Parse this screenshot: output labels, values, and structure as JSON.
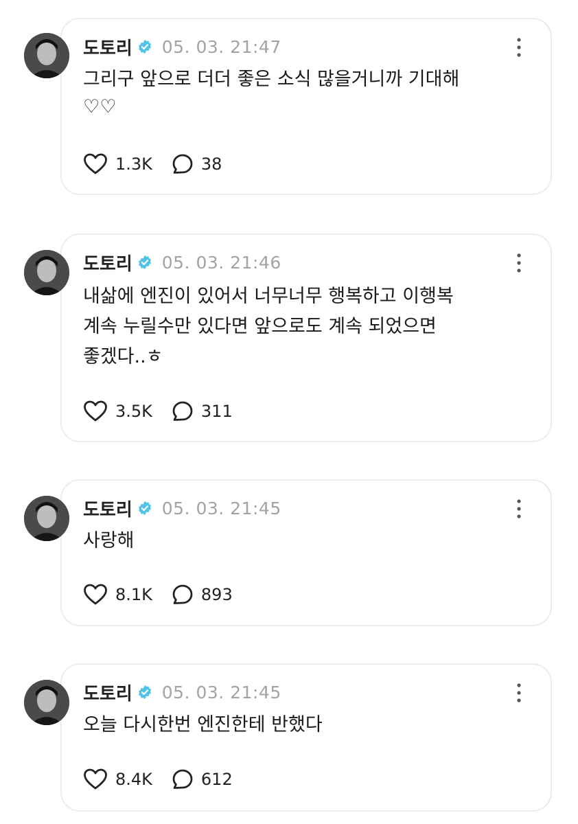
{
  "posts": [
    {
      "author": "도토리",
      "timestamp": "05. 03. 21:47",
      "text": "그리구 앞으로 더더 좋은 소식 많을거니까 기대해\n♡♡",
      "likes": "1.3K",
      "replies": "38"
    },
    {
      "author": "도토리",
      "timestamp": "05. 03. 21:46",
      "text": "내삶에 엔진이 있어서 너무너무 행복하고 이행복\n계속 누릴수만 있다면 앞으로도 계속 되었으면\n좋겠다..ㅎ",
      "likes": "3.5K",
      "replies": "311"
    },
    {
      "author": "도토리",
      "timestamp": "05. 03. 21:45",
      "text": "사랑해",
      "likes": "8.1K",
      "replies": "893"
    },
    {
      "author": "도토리",
      "timestamp": "05. 03. 21:45",
      "text": "오늘 다시한번 엔진한테 반했다",
      "likes": "8.4K",
      "replies": "612"
    }
  ],
  "icons": {
    "verified": "verified-badge-icon",
    "more": "more-vertical-icon",
    "like": "heart-icon",
    "reply": "speech-bubble-icon"
  },
  "colors": {
    "verified_badge": "#4fc3e8",
    "timestamp": "#a3a3a3",
    "card_border": "#ececec"
  }
}
